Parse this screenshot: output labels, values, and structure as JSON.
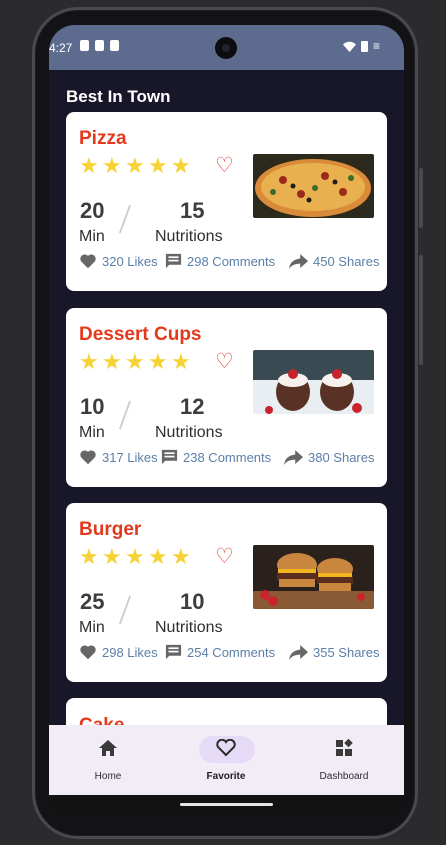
{
  "status_bar": {
    "time": "4:27",
    "right_glyph": "≡"
  },
  "section": {
    "title": "Best In Town"
  },
  "cards": [
    {
      "title": "Pizza",
      "rating": 5,
      "value_left": "20",
      "unit_left": "Min",
      "value_right": "15",
      "unit_right": "Nutritions",
      "likes": "320 Likes",
      "comments": "298 Comments",
      "shares": "450 Shares"
    },
    {
      "title": "Dessert Cups",
      "rating": 5,
      "value_left": "10",
      "unit_left": "Min",
      "value_right": "12",
      "unit_right": "Nutritions",
      "likes": "317 Likes",
      "comments": "238 Comments",
      "shares": "380 Shares"
    },
    {
      "title": "Burger",
      "rating": 5,
      "value_left": "25",
      "unit_left": "Min",
      "value_right": "10",
      "unit_right": "Nutritions",
      "likes": "298 Likes",
      "comments": "254 Comments",
      "shares": "355 Shares"
    }
  ],
  "peek_card": {
    "title": "Cake"
  },
  "nav": [
    {
      "label": "Home",
      "icon": "home-icon",
      "active": false
    },
    {
      "label": "Favorite",
      "icon": "heart-outline-icon",
      "active": true
    },
    {
      "label": "Dashboard",
      "icon": "dashboard-icon",
      "active": false
    }
  ],
  "colors": {
    "accent_red": "#e3391c",
    "star": "#f6d235",
    "stat_text": "#5b7fa8",
    "nav_bg": "#f1ecf6",
    "nav_pill": "#e6dbf7",
    "screen_bg": "#181729",
    "status_bg": "#5c6b8e"
  }
}
